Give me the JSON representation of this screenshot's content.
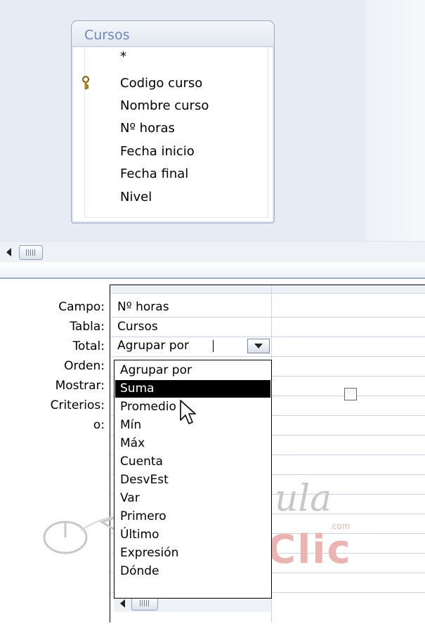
{
  "table": {
    "title": "Cursos",
    "fields": [
      "*",
      "Codigo curso",
      "Nombre curso",
      "Nº horas",
      "Fecha inicio",
      "Fecha final",
      "Nivel"
    ],
    "primary_key_field": "Codigo curso"
  },
  "grid": {
    "row_labels": {
      "campo": "Campo:",
      "tabla": "Tabla:",
      "total": "Total:",
      "orden": "Orden:",
      "mostrar": "Mostrar:",
      "criterios": "Criterios:",
      "o": "o:"
    },
    "column1": {
      "campo": "Nº horas",
      "tabla": "Cursos",
      "total": "Agrupar por"
    },
    "mostrar_checked": false
  },
  "total_dropdown": {
    "options": [
      "Agrupar por",
      "Suma",
      "Promedio",
      "Mín",
      "Máx",
      "Cuenta",
      "DesvEst",
      "Var",
      "Primero",
      "Último",
      "Expresión",
      "Dónde"
    ],
    "highlighted": "Suma"
  },
  "watermark": {
    "aula": "aula",
    "com": ".com",
    "clic": "Clic"
  },
  "icons": {
    "key": "key-icon",
    "scroll_left": "scroll-left-arrow-icon",
    "dropdown": "chevron-down-icon",
    "cursor": "mouse-pointer-icon"
  },
  "colors": {
    "design_background": "#e7ebf3",
    "table_title": "#6c88b6",
    "selection": "#000000"
  }
}
